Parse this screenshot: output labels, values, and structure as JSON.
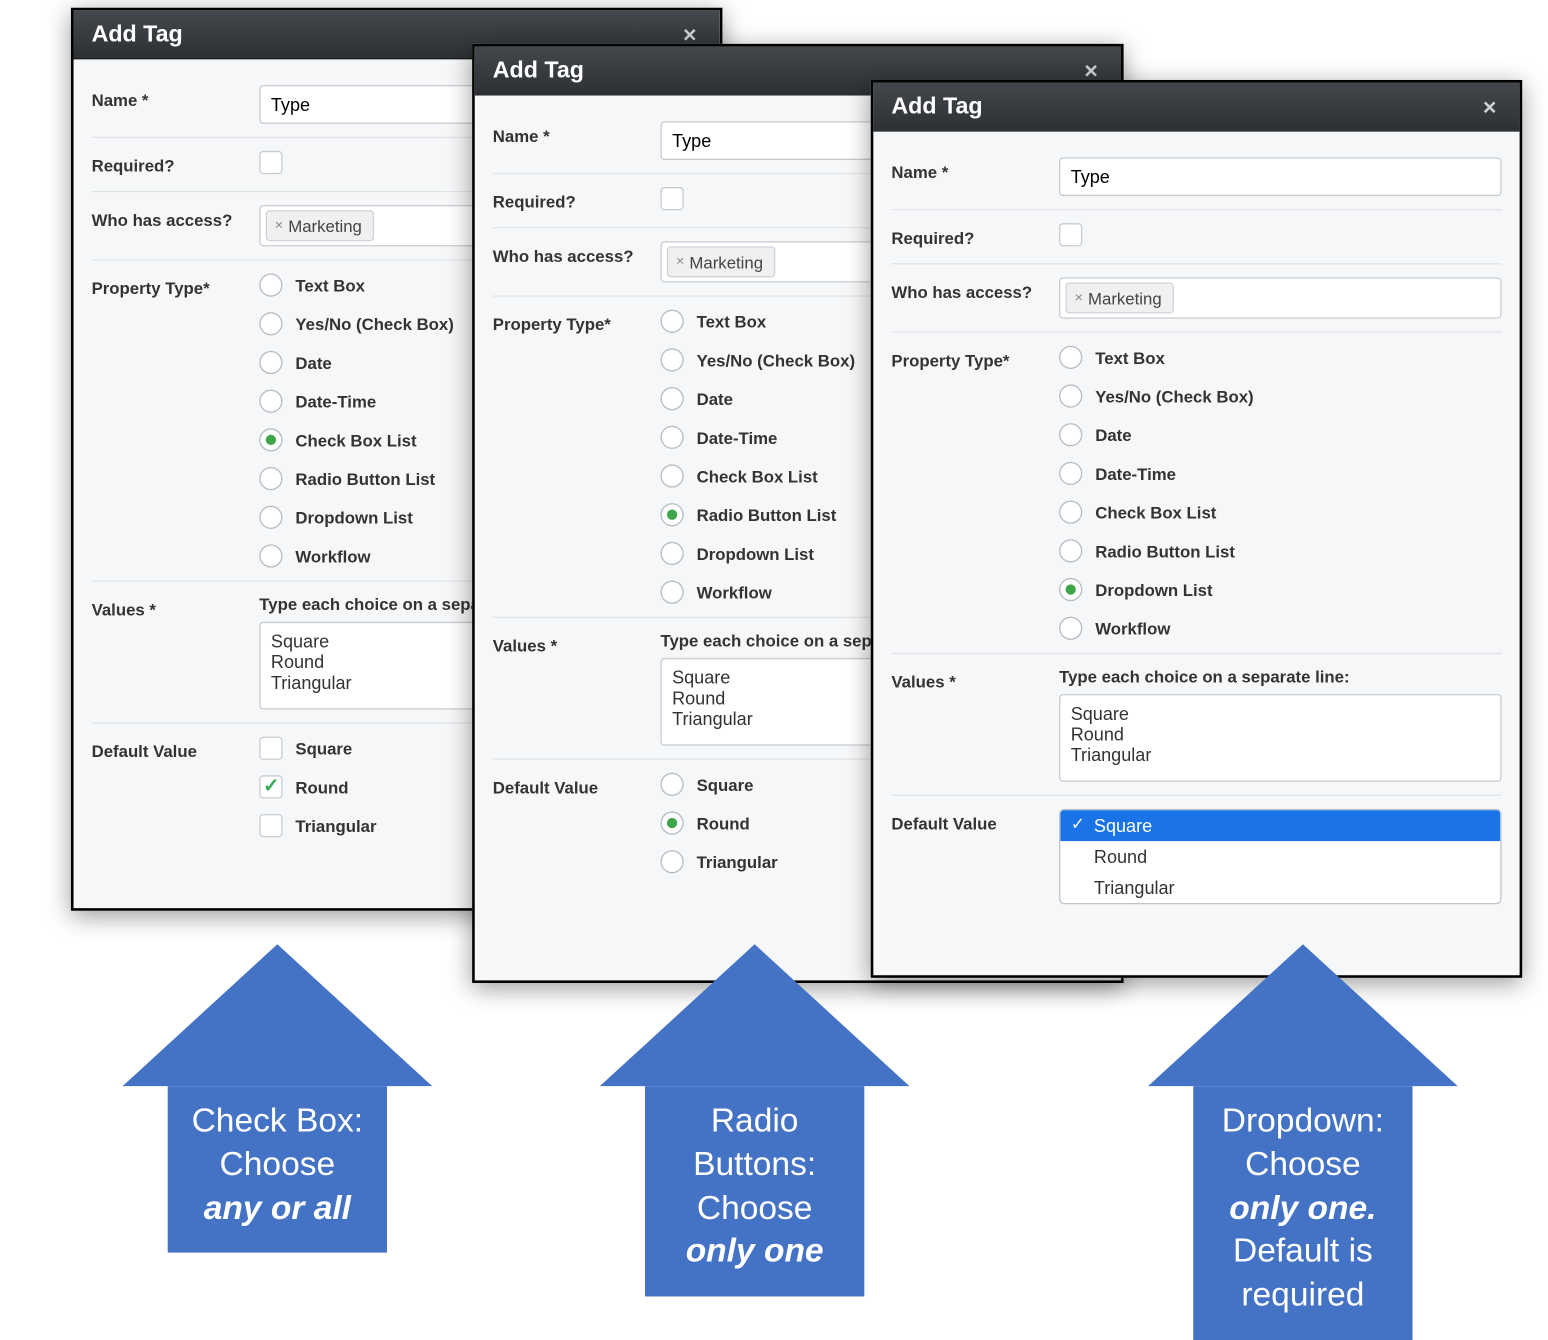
{
  "dialogs": {
    "checkbox": {
      "title": "Add Tag",
      "name_label": "Name *",
      "name_value": "Type",
      "required_label": "Required?",
      "access_label": "Who has access?",
      "access_chip": "Marketing",
      "ptype_label": "Property Type*",
      "ptype_options": [
        "Text Box",
        "Yes/No (Check Box)",
        "Date",
        "Date-Time",
        "Check Box List",
        "Radio Button List",
        "Dropdown List",
        "Workflow"
      ],
      "ptype_selected": "Check Box List",
      "values_label": "Values *",
      "values_hint": "Type each choice on a separate",
      "values_text": "Square\nRound\nTriangular",
      "default_label": "Default Value",
      "default_options": [
        "Square",
        "Round",
        "Triangular"
      ],
      "default_checked": "Round"
    },
    "radio": {
      "title": "Add Tag",
      "name_label": "Name *",
      "name_value": "Type",
      "required_label": "Required?",
      "access_label": "Who has access?",
      "access_chip": "Marketing",
      "ptype_label": "Property Type*",
      "ptype_options": [
        "Text Box",
        "Yes/No (Check Box)",
        "Date",
        "Date-Time",
        "Check Box List",
        "Radio Button List",
        "Dropdown List",
        "Workflow"
      ],
      "ptype_selected": "Radio Button List",
      "values_label": "Values *",
      "values_hint": "Type each choice on a separate",
      "values_text": "Square\nRound\nTriangular",
      "default_label": "Default Value",
      "default_options": [
        "Square",
        "Round",
        "Triangular"
      ],
      "default_selected": "Round"
    },
    "dropdown": {
      "title": "Add Tag",
      "name_label": "Name *",
      "name_value": "Type",
      "required_label": "Required?",
      "access_label": "Who has access?",
      "access_chip": "Marketing",
      "ptype_label": "Property Type*",
      "ptype_options": [
        "Text Box",
        "Yes/No (Check Box)",
        "Date",
        "Date-Time",
        "Check Box List",
        "Radio Button List",
        "Dropdown List",
        "Workflow"
      ],
      "ptype_selected": "Dropdown List",
      "values_label": "Values *",
      "values_hint": "Type each choice on a separate line:",
      "values_text": "Square\nRound\nTriangular",
      "default_label": "Default Value",
      "default_options": [
        "Square",
        "Round",
        "Triangular"
      ],
      "default_selected": "Square"
    }
  },
  "callouts": {
    "checkbox_l1": "Check Box:",
    "checkbox_l2": "Choose",
    "checkbox_l3": "any or all",
    "radio_l1": "Radio",
    "radio_l2": "Buttons:",
    "radio_l3": "Choose",
    "radio_l4": "only one",
    "dropdown_l1": "Dropdown:",
    "dropdown_l2": "Choose",
    "dropdown_l3": "only one.",
    "dropdown_l4": "Default is",
    "dropdown_l5": "required"
  },
  "icons": {
    "close": "×",
    "chip_x": "×"
  }
}
